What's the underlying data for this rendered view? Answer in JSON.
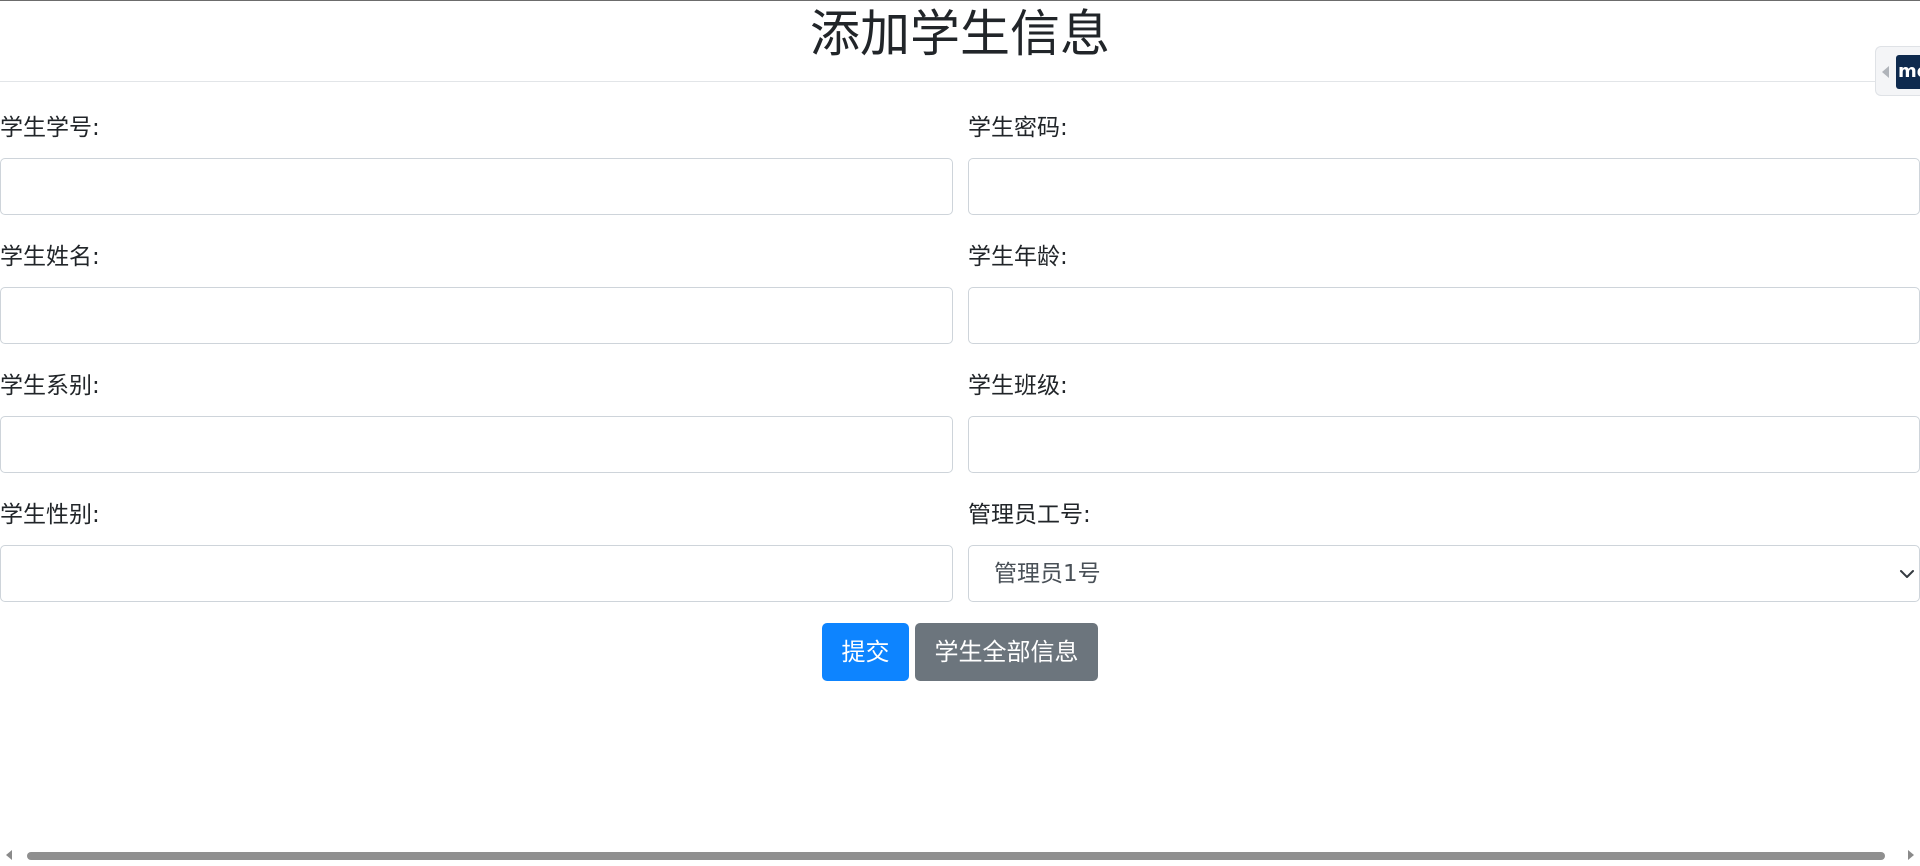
{
  "page": {
    "title": "添加学生信息"
  },
  "form": {
    "student_id_label": "学生学号:",
    "student_password_label": "学生密码:",
    "student_name_label": "学生姓名:",
    "student_age_label": "学生年龄:",
    "student_department_label": "学生系别:",
    "student_class_label": "学生班级:",
    "student_gender_label": "学生性别:",
    "admin_id_label": "管理员工号:",
    "student_id_value": "",
    "student_password_value": "",
    "student_name_value": "",
    "student_age_value": "",
    "student_department_value": "",
    "student_class_value": "",
    "student_gender_value": "",
    "admin_select_value": "管理员1号"
  },
  "buttons": {
    "submit_label": "提交",
    "all_students_label": "学生全部信息"
  },
  "side_widget": {
    "logo_text": "me"
  },
  "colors": {
    "primary": "#0d84ff",
    "secondary": "#6c757d",
    "input_border": "#ced4da"
  },
  "icons": {
    "select_arrow": "chevron-down-icon",
    "widget_arrow": "caret-left-icon",
    "scroll_left": "caret-left-icon",
    "scroll_right": "caret-right-icon"
  }
}
